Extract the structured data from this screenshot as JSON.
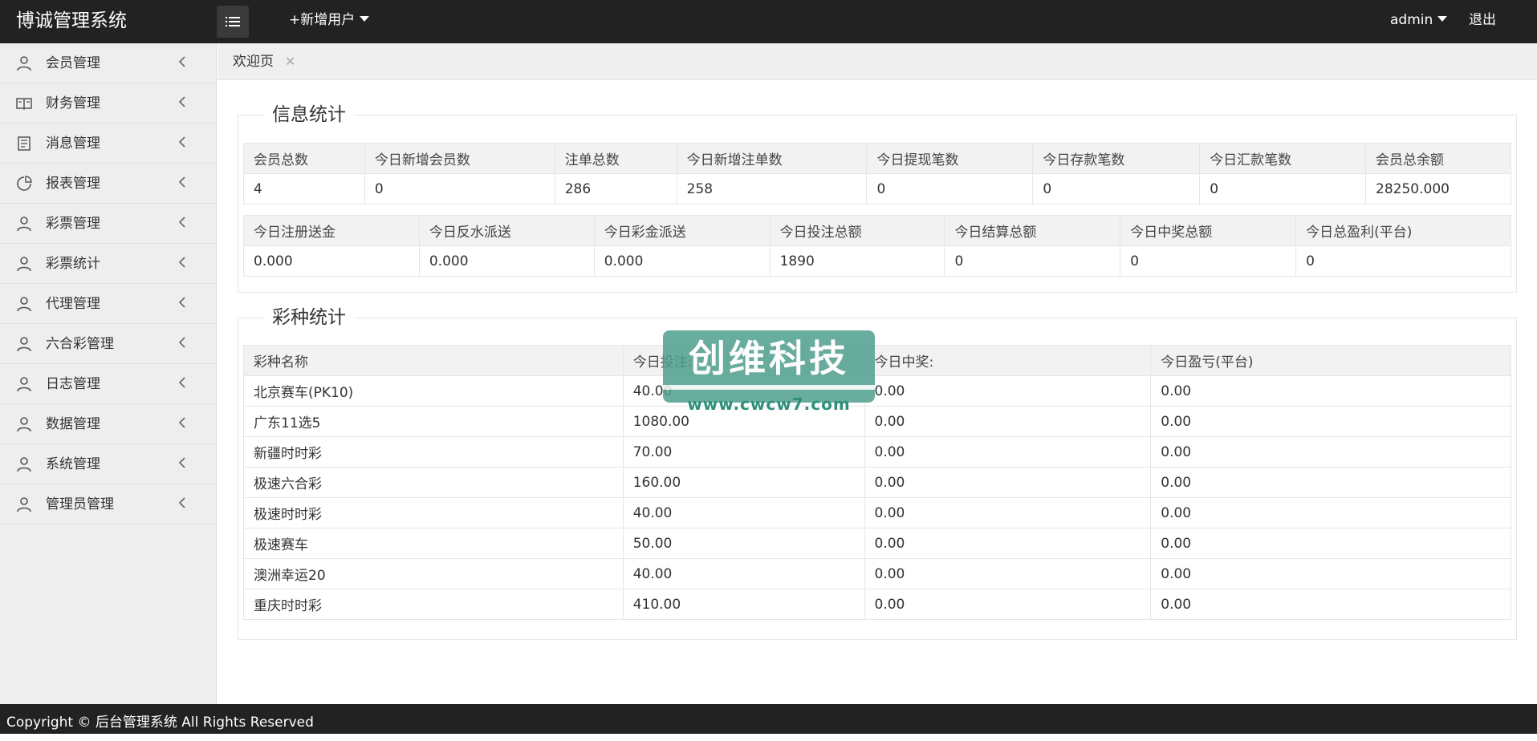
{
  "header": {
    "title": "博诚管理系统",
    "add_user": "+新增用户",
    "user": "admin",
    "logout": "退出"
  },
  "sidebar": {
    "items": [
      {
        "label": "会员管理",
        "icon": "user-icon"
      },
      {
        "label": "财务管理",
        "icon": "book-icon"
      },
      {
        "label": "消息管理",
        "icon": "message-icon"
      },
      {
        "label": "报表管理",
        "icon": "chart-icon"
      },
      {
        "label": "彩票管理",
        "icon": "user-icon"
      },
      {
        "label": "彩票统计",
        "icon": "user-icon"
      },
      {
        "label": "代理管理",
        "icon": "user-icon"
      },
      {
        "label": "六合彩管理",
        "icon": "user-icon"
      },
      {
        "label": "日志管理",
        "icon": "user-icon"
      },
      {
        "label": "数据管理",
        "icon": "user-icon"
      },
      {
        "label": "系统管理",
        "icon": "user-icon"
      },
      {
        "label": "管理员管理",
        "icon": "user-icon"
      }
    ]
  },
  "tabs": [
    {
      "label": "欢迎页",
      "close": "✕"
    }
  ],
  "info_stats": {
    "legend": "信息统计",
    "table1": {
      "headers": [
        "会员总数",
        "今日新增会员数",
        "注单总数",
        "今日新增注单数",
        "今日提现笔数",
        "今日存款笔数",
        "今日汇款笔数",
        "会员总余额"
      ],
      "values": [
        "4",
        "0",
        "286",
        "258",
        "0",
        "0",
        "0",
        "28250.000"
      ]
    },
    "table2": {
      "headers": [
        "今日注册送金",
        "今日反水派送",
        "今日彩金派送",
        "今日投注总额",
        "今日结算总额",
        "今日中奖总额",
        "今日总盈利(平台)"
      ],
      "values": [
        "0.000",
        "0.000",
        "0.000",
        "1890",
        "0",
        "0",
        "0"
      ]
    }
  },
  "lottery_stats": {
    "legend": "彩种统计",
    "headers": [
      "彩种名称",
      "今日投注:",
      "今日中奖:",
      "今日盈亏(平台)"
    ],
    "rows": [
      [
        "北京赛车(PK10)",
        "40.00",
        "0.00",
        "0.00"
      ],
      [
        "广东11选5",
        "1080.00",
        "0.00",
        "0.00"
      ],
      [
        "新疆时时彩",
        "70.00",
        "0.00",
        "0.00"
      ],
      [
        "极速六合彩",
        "160.00",
        "0.00",
        "0.00"
      ],
      [
        "极速时时彩",
        "40.00",
        "0.00",
        "0.00"
      ],
      [
        "极速赛车",
        "50.00",
        "0.00",
        "0.00"
      ],
      [
        "澳洲幸运20",
        "40.00",
        "0.00",
        "0.00"
      ],
      [
        "重庆时时彩",
        "410.00",
        "0.00",
        "0.00"
      ]
    ]
  },
  "watermark": {
    "text": "创维科技",
    "url": "www.cwcw7.com",
    "color": "#4e9f8e"
  },
  "footer": {
    "text": "Copyright © 后台管理系统 All Rights Reserved"
  }
}
